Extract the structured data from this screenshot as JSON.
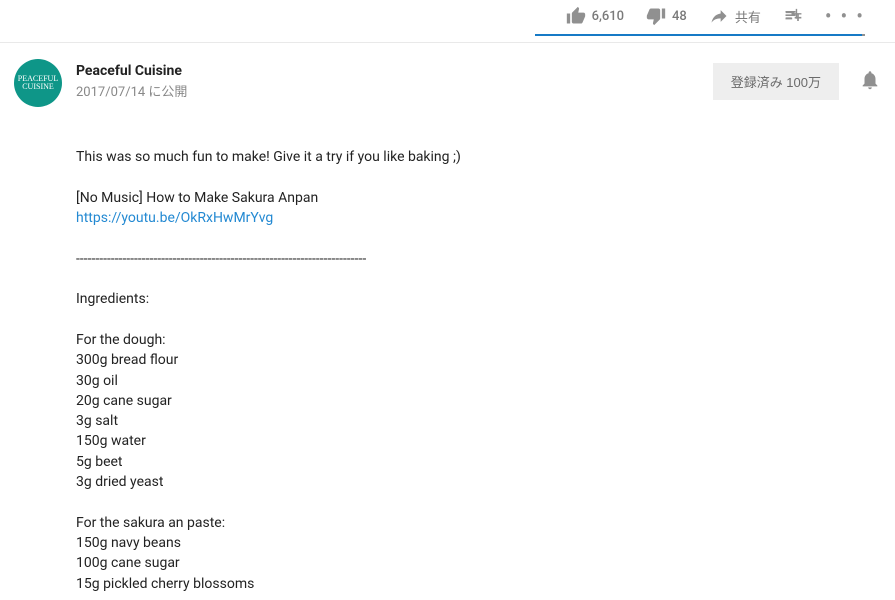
{
  "actions": {
    "likes": "6,610",
    "dislikes": "48",
    "share_label": "共有",
    "like_ratio_pct": 99
  },
  "channel": {
    "name": "Peaceful Cuisine",
    "avatar_text": "PEACEFUL\nCUISINE",
    "publish_text": "2017/07/14 に公開",
    "subscribe_button": "登録済み  100万"
  },
  "description": {
    "intro": "This was so much fun to make! Give it a try if you like baking ;)",
    "alt_title": "[No Music] How to Make Sakura Anpan",
    "link_text": "https://youtu.be/OkRxHwMrYvg",
    "divider": "---------------------------------------------------------------------------",
    "ingredients_header": "Ingredients:",
    "dough_header": "For the dough:",
    "dough_lines": "300g bread flour\n30g oil\n20g cane sugar\n3g salt\n150g water\n5g beet\n3g dried yeast",
    "paste_header": "For the sakura an paste:",
    "paste_lines": "150g navy beans\n100g cane sugar\n15g pickled cherry blossoms"
  }
}
